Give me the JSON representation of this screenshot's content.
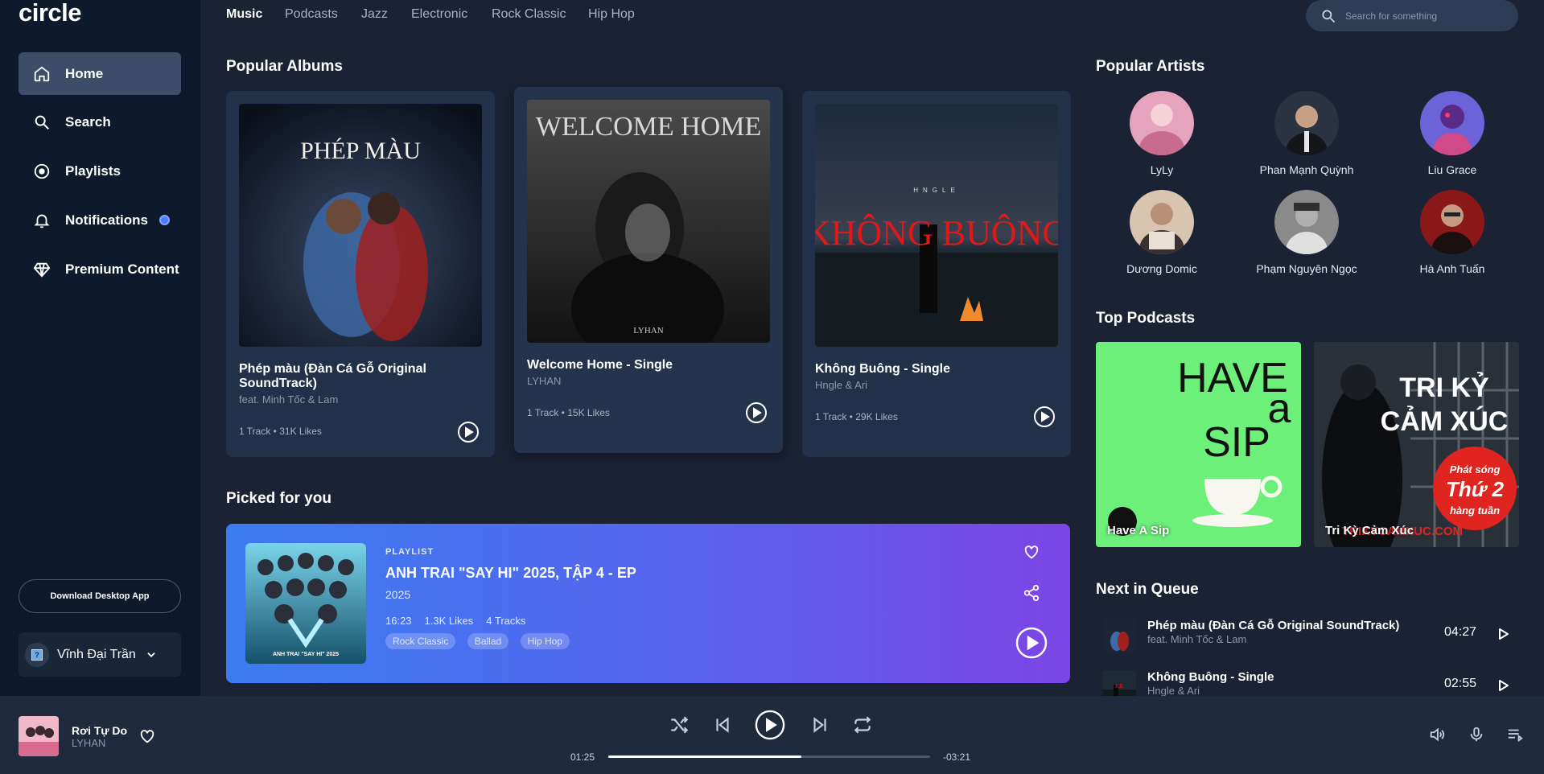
{
  "app": {
    "logo": "circle"
  },
  "sidebar": {
    "items": [
      {
        "label": "Home",
        "icon": "home-icon",
        "active": true
      },
      {
        "label": "Search",
        "icon": "search-icon"
      },
      {
        "label": "Playlists",
        "icon": "playlist-icon"
      },
      {
        "label": "Notifications",
        "icon": "bell-icon"
      },
      {
        "label": "Premium Content",
        "icon": "diamond-icon"
      }
    ],
    "download_label": "Download Desktop App",
    "user_name": "Vĩnh Đại Trần"
  },
  "tabs": [
    "Music",
    "Podcasts",
    "Jazz",
    "Electronic",
    "Rock Classic",
    "Hip Hop"
  ],
  "search": {
    "placeholder": "Search for something"
  },
  "popular_albums": {
    "title": "Popular Albums",
    "items": [
      {
        "title": "Phép màu (Đàn Cá Gỗ Original SoundTrack)",
        "artist": "feat. Minh Tốc & Lam",
        "meta": "1 Track • 31K Likes",
        "cover_text": "PHÉP MÀU"
      },
      {
        "title": "Welcome Home - Single",
        "artist": "LYHAN",
        "meta": "1 Track • 15K Likes",
        "cover_text": "WELCOME HOME",
        "cover_sub": "LYHAN"
      },
      {
        "title": "Không Buông - Single",
        "artist": "Hngle & Ari",
        "meta": "1 Track • 29K Likes",
        "cover_text": "KHÔNG BUÔNG",
        "cover_sub": "HNGLE"
      }
    ]
  },
  "picked": {
    "title": "Picked for you",
    "kind": "PLAYLIST",
    "name": "ANH TRAI \"SAY HI\" 2025, TẬP 4 - EP",
    "year": "2025",
    "duration": "16:23",
    "likes": "1.3K Likes",
    "tracks": "4 Tracks",
    "tags": [
      "Rock Classic",
      "Ballad",
      "Hip Hop"
    ],
    "cover_text": "ANH TRAI \"SAY HI\" 2025"
  },
  "popular_artists": {
    "title": "Popular Artists",
    "items": [
      "LyLy",
      "Phan Mạnh Quỳnh",
      "Liu Grace",
      "Dương Domic",
      "Phạm Nguyên Ngọc",
      "Hà Anh Tuấn"
    ]
  },
  "top_podcasts": {
    "title": "Top Podcasts",
    "items": [
      {
        "name": "Have A Sip",
        "art_text": [
          "HAVE",
          "a",
          "SIP"
        ]
      },
      {
        "name": "Tri Kỳ Cảm Xúc",
        "art_text": [
          "TRI KỶ",
          "CẢM XÚC"
        ],
        "badge": [
          "Phát sóng",
          "Thứ 2",
          "hàng tuần"
        ],
        "url_text": "TRIKYCAMXUC.COM"
      }
    ]
  },
  "queue": {
    "title": "Next in Queue",
    "items": [
      {
        "title": "Phép màu (Đàn Cá Gỗ Original SoundTrack)",
        "artist": "feat. Minh Tốc & Lam",
        "duration": "04:27"
      },
      {
        "title": "Không Buông - Single",
        "artist": "Hngle & Ari",
        "duration": "02:55"
      }
    ]
  },
  "player": {
    "title": "Rơi Tự Do",
    "artist": "LYHAN",
    "elapsed": "01:25",
    "remaining": "-03:21",
    "progress": 0.6
  }
}
